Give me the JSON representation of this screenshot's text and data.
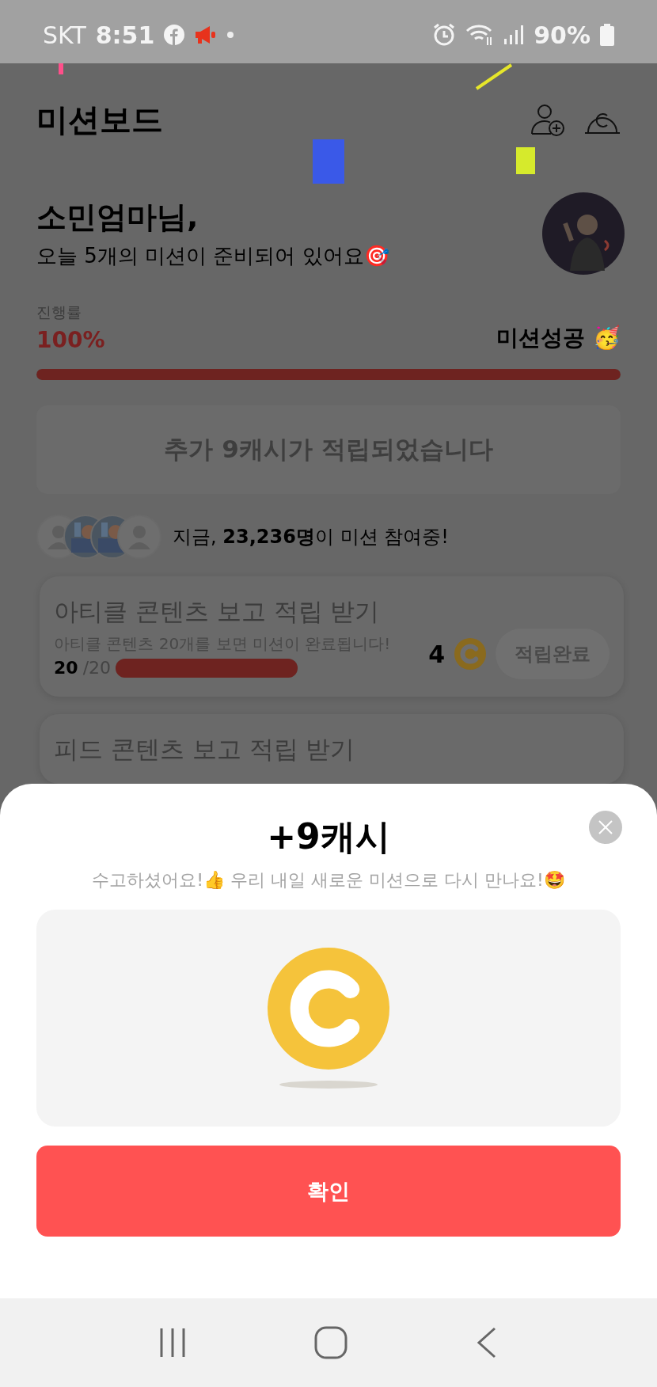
{
  "status_bar": {
    "carrier": "SKT",
    "time": "8:51",
    "battery": "90%"
  },
  "header": {
    "title": "미션보드"
  },
  "greeting": {
    "name": "소민엄마님,",
    "message": "오늘 5개의 미션이 준비되어 있어요🎯"
  },
  "progress": {
    "label": "진행률",
    "percent": "100%",
    "status": "미션성공 🥳",
    "level": 1
  },
  "bonus_banner": "추가 9캐시가 적립되었습니다",
  "participants": {
    "text": "지금, **23,236명**이 미션 참여중!",
    "avatars": [
      {
        "kind": "placeholder"
      },
      {
        "kind": "picture"
      },
      {
        "kind": "picture"
      },
      {
        "kind": "placeholder"
      }
    ]
  },
  "missions": [
    {
      "title": "아티클 콘텐츠 보고 적립 받기",
      "description": "아티클 콘텐츠 20개를 보면 미션이 완료됩니다!",
      "reward": "4",
      "done_count": "20",
      "total": "/20",
      "level": 1,
      "button": "적립완료",
      "completed": true
    },
    {
      "title": "피드 콘텐츠 보고 적립 받기"
    }
  ],
  "modal": {
    "title": "+9캐시",
    "message": "수고하셨어요!👍 우리 내일 새로운 미션으로 다시 만나요!🤩",
    "button": "확인"
  }
}
